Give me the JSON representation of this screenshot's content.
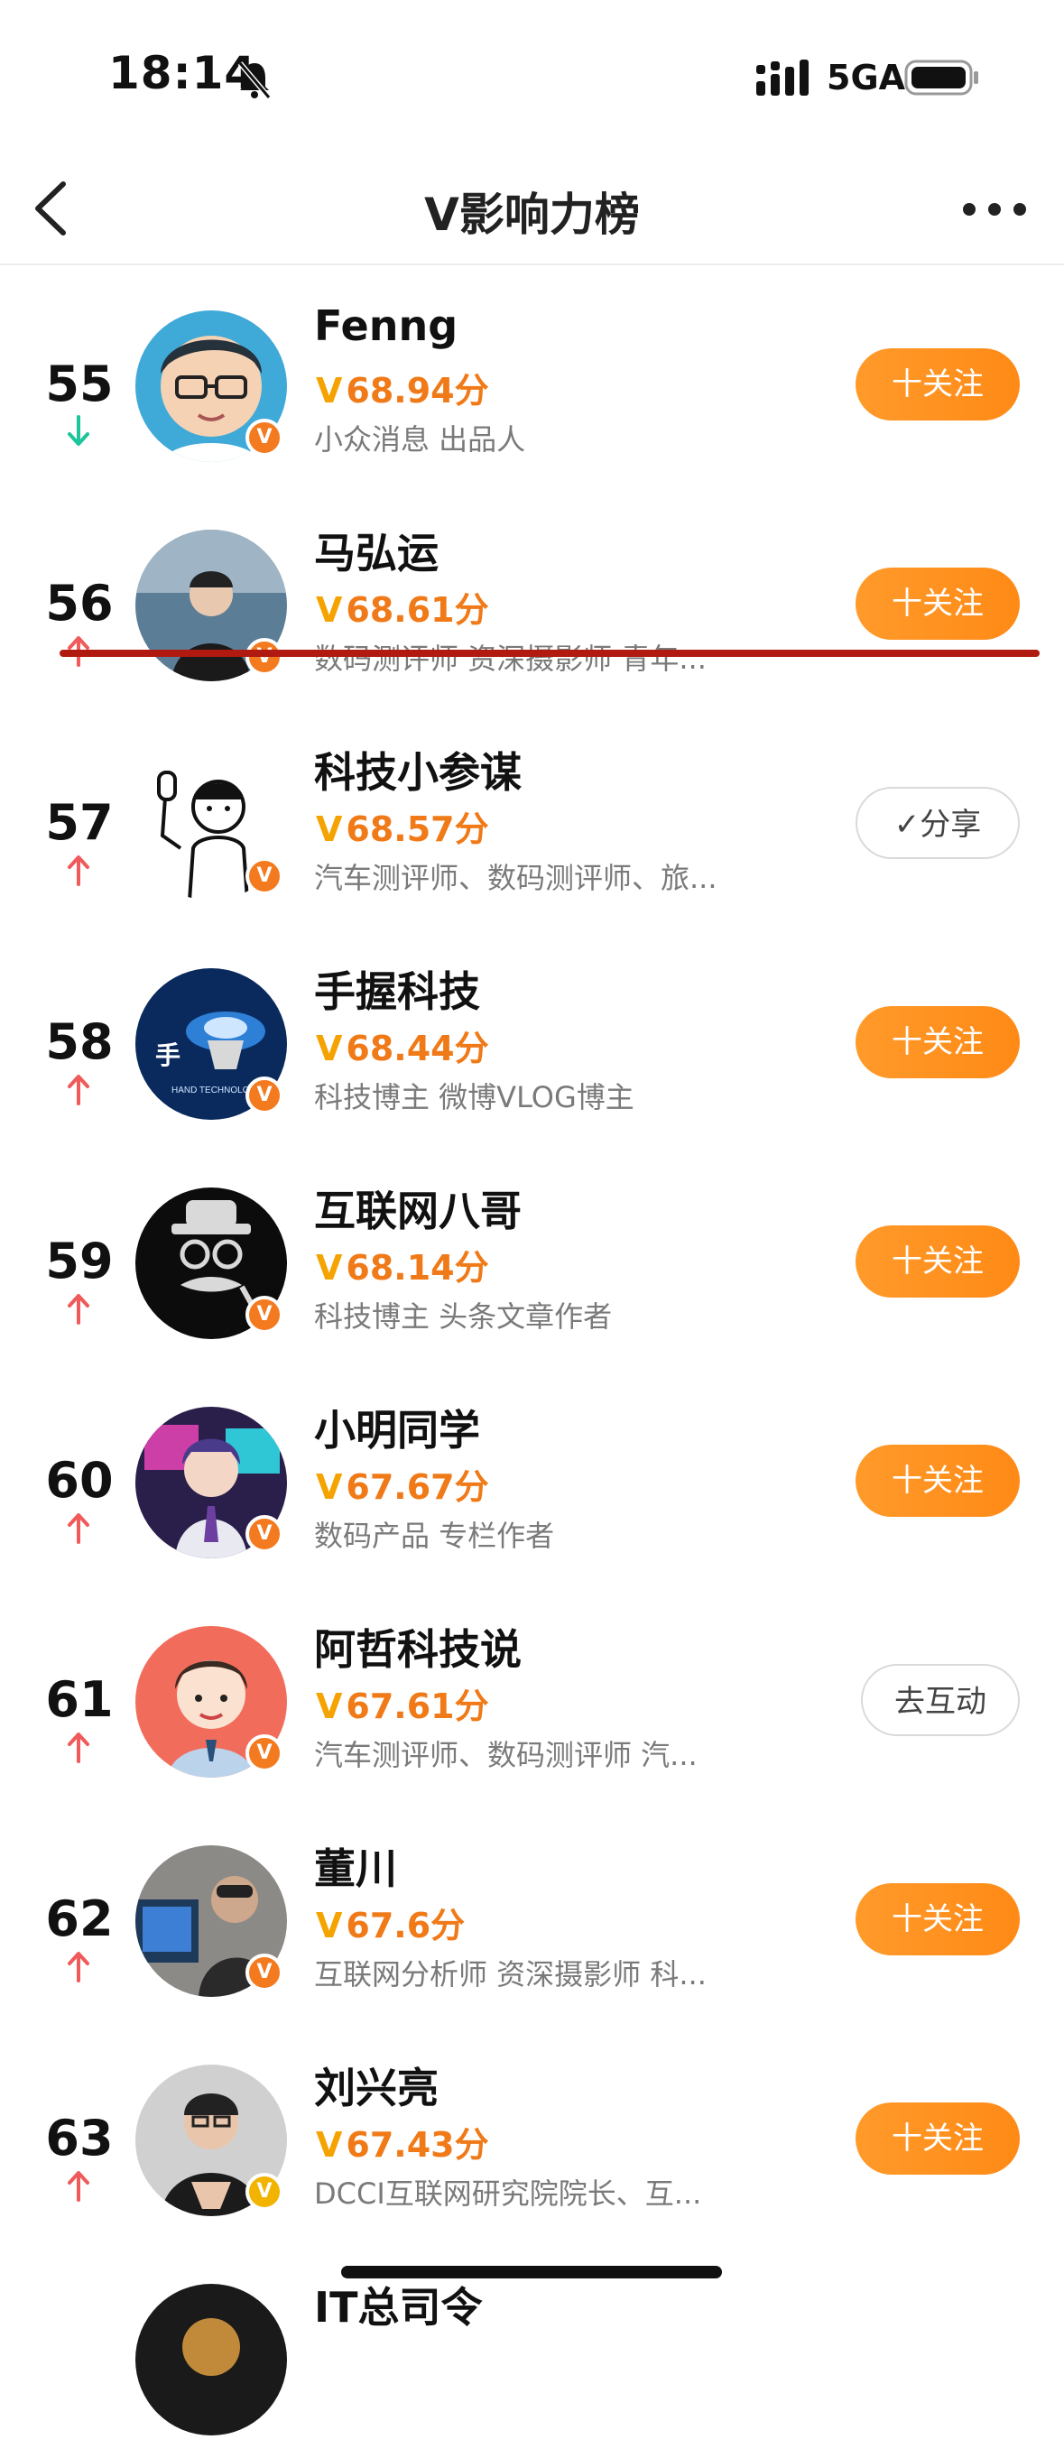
{
  "status_bar": {
    "time": "18:14",
    "network": "5GA",
    "icons": [
      "bell-slash-icon",
      "signal-icon",
      "battery-icon"
    ]
  },
  "nav": {
    "title": "V影响力榜",
    "back_icon": "chevron-left-icon",
    "more_icon": "more-dots-icon"
  },
  "colors": {
    "accent": "#ff8a16",
    "score": "#f07a18",
    "trend_up": "#f05a5a",
    "trend_down": "#1cc59a",
    "mark_line": "#b01a10"
  },
  "ranking": [
    {
      "rank": "55",
      "trend": "down",
      "name": "Fenng",
      "v": "V",
      "score": "68.94分",
      "desc": "小众消息 出品人",
      "button": "十关注",
      "button_type": "follow"
    },
    {
      "rank": "56",
      "trend": "up",
      "name": "马弘运",
      "v": "V",
      "score": "68.61分",
      "desc": "数码测评师 资深摄影师 青年...",
      "button": "十关注",
      "button_type": "follow"
    },
    {
      "rank": "57",
      "trend": "up",
      "name": "科技小参谋",
      "v": "V",
      "score": "68.57分",
      "desc": "汽车测评师、数码测评师、旅...",
      "button": "✓分享",
      "button_type": "share"
    },
    {
      "rank": "58",
      "trend": "up",
      "name": "手握科技",
      "v": "V",
      "score": "68.44分",
      "desc": "科技博主 微博VLOG博主",
      "button": "十关注",
      "button_type": "follow"
    },
    {
      "rank": "59",
      "trend": "up",
      "name": "互联网八哥",
      "v": "V",
      "score": "68.14分",
      "desc": "科技博主 头条文章作者",
      "button": "十关注",
      "button_type": "follow"
    },
    {
      "rank": "60",
      "trend": "up",
      "name": "小明同学",
      "v": "V",
      "score": "67.67分",
      "desc": "数码产品 专栏作者",
      "button": "十关注",
      "button_type": "follow"
    },
    {
      "rank": "61",
      "trend": "up",
      "name": "阿哲科技说",
      "v": "V",
      "score": "67.61分",
      "desc": "汽车测评师、数码测评师 汽...",
      "button": "去互动",
      "button_type": "interact"
    },
    {
      "rank": "62",
      "trend": "up",
      "name": "董川",
      "v": "V",
      "score": "67.6分",
      "desc": "互联网分析师 资深摄影师 科...",
      "button": "十关注",
      "button_type": "follow"
    },
    {
      "rank": "63",
      "trend": "up",
      "name": "刘兴亮",
      "v": "V",
      "score": "67.43分",
      "desc": "DCCI互联网研究院院长、互...",
      "button": "十关注",
      "button_type": "follow"
    },
    {
      "rank": "",
      "trend": "",
      "name": "IT总司令",
      "v": "",
      "score": "",
      "desc": "",
      "button": "",
      "button_type": "none"
    }
  ]
}
